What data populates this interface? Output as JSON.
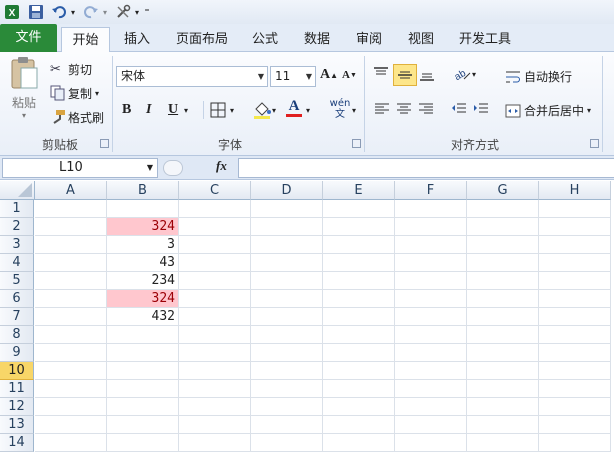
{
  "qat": {
    "icons": [
      "excel-logo-icon",
      "save-icon",
      "undo-icon",
      "redo-icon",
      "customize-icon"
    ]
  },
  "tabs": {
    "file": "文件",
    "home": "开始",
    "insert": "插入",
    "page_layout": "页面布局",
    "formulas": "公式",
    "data": "数据",
    "review": "审阅",
    "view": "视图",
    "developer": "开发工具"
  },
  "clipboard": {
    "paste": "粘贴",
    "cut": "剪切",
    "copy": "复制",
    "format_painter": "格式刷",
    "label": "剪贴板"
  },
  "font": {
    "name": "宋体",
    "size": "11",
    "label": "字体",
    "bold": "B",
    "italic": "I",
    "underline": "U",
    "font_color_letter": "A",
    "phonetic": "wén 文"
  },
  "alignment": {
    "wrap": "自动换行",
    "merge": "合并后居中",
    "label": "对齐方式"
  },
  "namebox": {
    "value": "L10"
  },
  "formula_icon": "fx",
  "columns": [
    "A",
    "B",
    "C",
    "D",
    "E",
    "F",
    "G",
    "H"
  ],
  "rows": [
    "1",
    "2",
    "3",
    "4",
    "5",
    "6",
    "7",
    "8",
    "9",
    "10",
    "11",
    "12",
    "13",
    "14"
  ],
  "active_row": "10",
  "cells": {
    "B2": "324",
    "B3": "3",
    "B4": "43",
    "B5": "234",
    "B6": "324",
    "B7": "432"
  },
  "highlight_color": "#ffc7ce",
  "accent_file_tab": "#2a8a39"
}
